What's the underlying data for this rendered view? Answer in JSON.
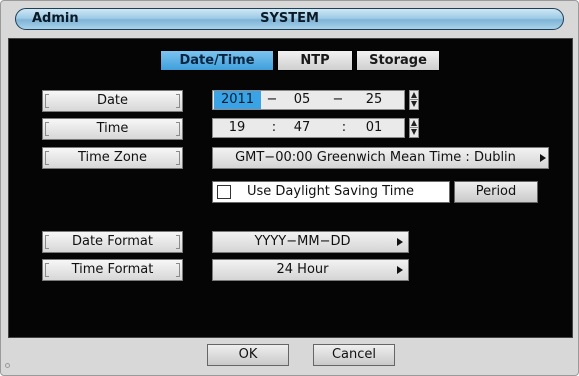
{
  "title": {
    "left": "Admin",
    "center": "SYSTEM"
  },
  "tabs": [
    {
      "label": "Date/Time",
      "active": true
    },
    {
      "label": "NTP",
      "active": false
    },
    {
      "label": "Storage",
      "active": false
    }
  ],
  "labels": {
    "date": "Date",
    "time": "Time",
    "timezone": "Time Zone",
    "date_format": "Date Format",
    "time_format": "Time Format"
  },
  "date": {
    "year": "2011",
    "month": "05",
    "day": "25",
    "sep": "−"
  },
  "time": {
    "hour": "19",
    "minute": "47",
    "second": "01",
    "sep": ":"
  },
  "timezone_value": "GMT−00:00 Greenwich Mean Time : Dublin",
  "dst": {
    "label": "Use Daylight Saving Time",
    "checked": false,
    "period_label": "Period"
  },
  "date_format_value": "YYYY−MM−DD",
  "time_format_value": "24 Hour",
  "footer": {
    "ok": "OK",
    "cancel": "Cancel"
  },
  "colors": {
    "accent": "#3aa3e6",
    "panel": "#050505",
    "frame": "#d8d8d8"
  }
}
